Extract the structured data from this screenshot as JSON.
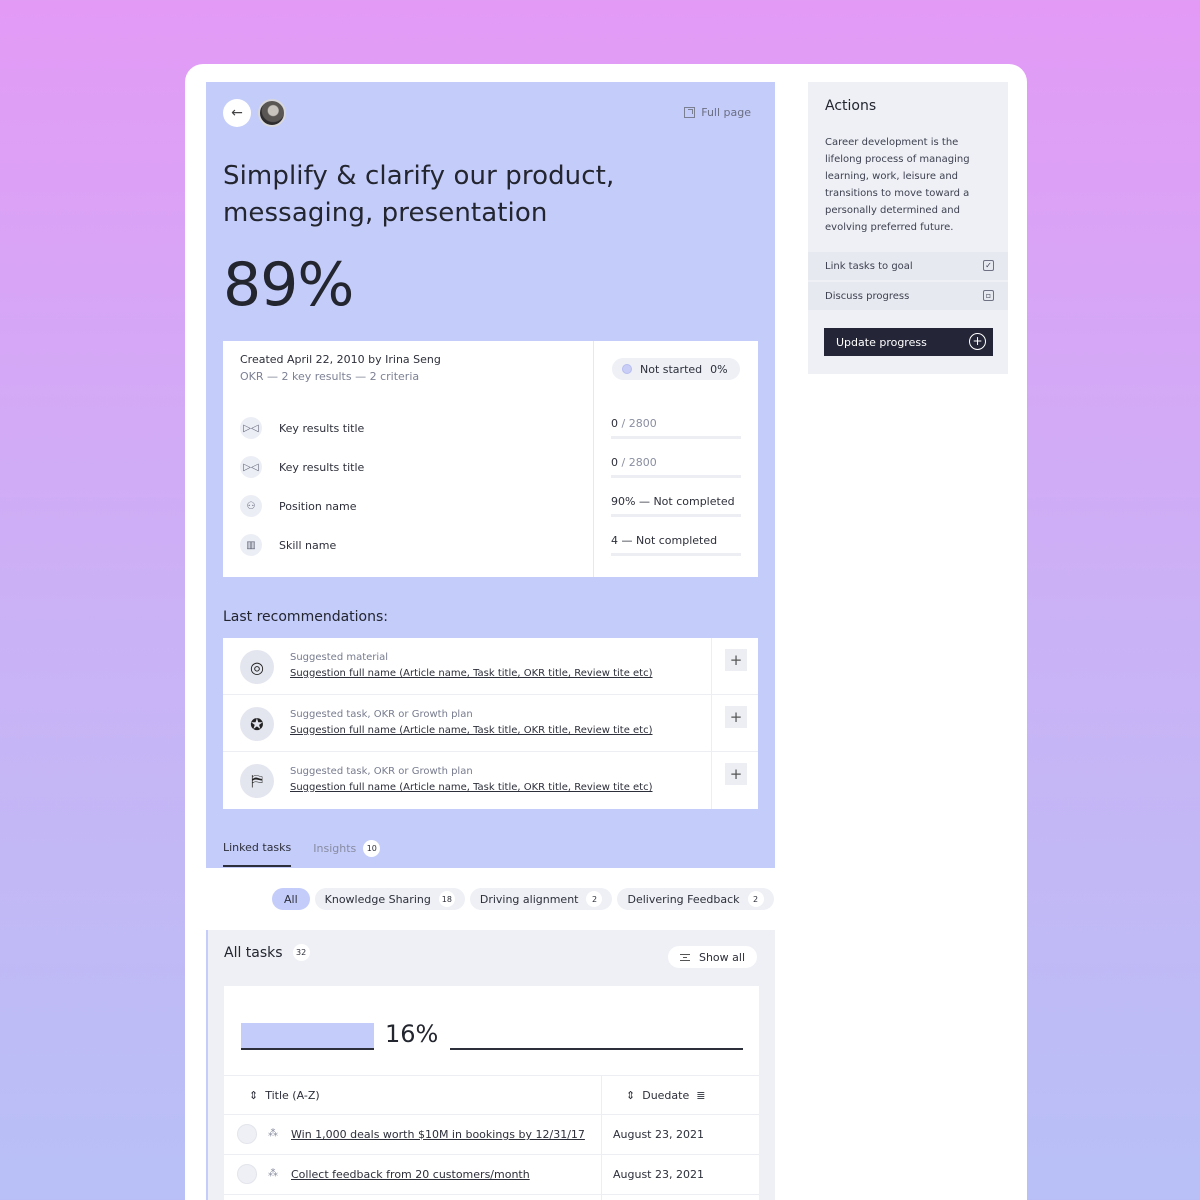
{
  "header": {
    "full_page_label": "Full page"
  },
  "goal": {
    "title": "Simplify & clarify our product, messaging, presentation",
    "percent": "89%",
    "created": "Created April 22, 2010 by Irina Seng",
    "meta": "OKR  —  2 key results  —  2 criteria",
    "status_label": "Not started",
    "status_percent": "0%",
    "key_results": [
      {
        "icon": "key-result-icon",
        "label": "Key results title",
        "value": "0",
        "value_suffix": " / 2800"
      },
      {
        "icon": "key-result-icon",
        "label": "Key results title",
        "value": "0",
        "value_suffix": " / 2800"
      },
      {
        "icon": "position-icon",
        "label": "Position name",
        "value": "90% — Not completed",
        "value_suffix": ""
      },
      {
        "icon": "skill-icon",
        "label": "Skill name",
        "value": "4 — Not completed",
        "value_suffix": ""
      }
    ]
  },
  "recommendations": {
    "heading": "Last recommendations:",
    "items": [
      {
        "type": "Suggested material",
        "link": "Suggestion full name (Article name, Task title, OKR title, Review tite etc)"
      },
      {
        "type": "Suggested task, OKR or Growth plan",
        "link": "Suggestion full name (Article name, Task title, OKR title, Review tite etc)"
      },
      {
        "type": "Suggested task, OKR or Growth plan",
        "link": "Suggestion full name (Article name, Task title, OKR title, Review tite etc)"
      }
    ]
  },
  "tabs": [
    {
      "label": "Linked tasks",
      "active": true
    },
    {
      "label": "Insights",
      "count": "10",
      "active": false
    }
  ],
  "chips": [
    {
      "label": "All",
      "count": "",
      "active": true
    },
    {
      "label": "Knowledge Sharing",
      "count": "18",
      "active": false
    },
    {
      "label": "Driving alignment",
      "count": "2",
      "active": false
    },
    {
      "label": "Delivering Feedback",
      "count": "2",
      "active": false
    }
  ],
  "tasks": {
    "title": "All tasks",
    "count": "32",
    "show_all": "Show all",
    "progress_label": "16%",
    "progress_value": 16,
    "col_title": "Title (A-Z)",
    "col_due": "Duedate",
    "rows": [
      {
        "title": "Win 1,000 deals worth $10M in bookings by 12/31/17",
        "due": "August 23, 2021"
      },
      {
        "title": "Collect feedback from 20 customers/month",
        "due": "August 23, 2021"
      }
    ]
  },
  "actions": {
    "title": "Actions",
    "description": "Career development is the lifelong process of managing learning, work, leisure and transitions to move toward a personally determined and evolving preferred future.",
    "items": [
      {
        "label": "Link tasks to goal",
        "icon": "checkbox-icon"
      },
      {
        "label": "Discuss progress",
        "icon": "calendar-icon"
      }
    ],
    "update_button": "Update progress"
  },
  "colors": {
    "accent": "#c4ccfa",
    "dark": "#242638",
    "panel": "#eef0f5"
  }
}
